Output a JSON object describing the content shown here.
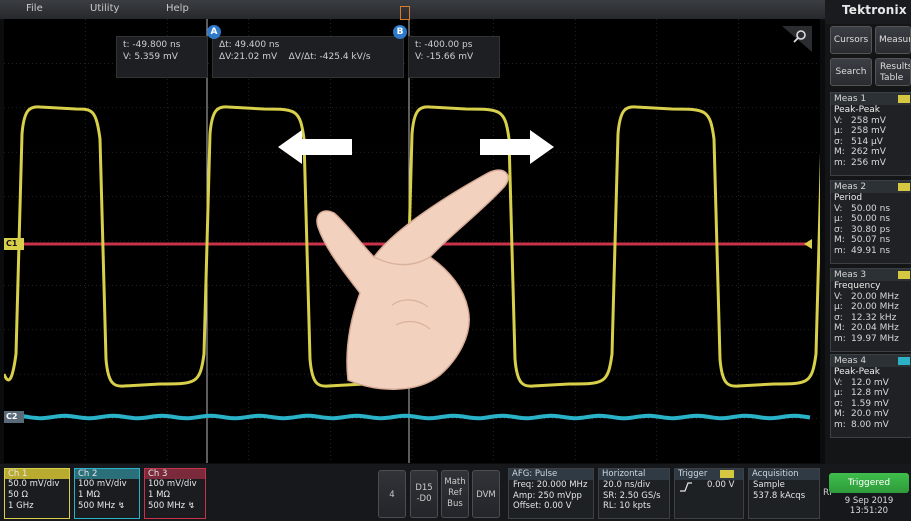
{
  "menu": {
    "file": "File",
    "utility": "Utility",
    "help": "Help"
  },
  "brand": "Tektronix",
  "side_buttons": {
    "cursors": "Cursors",
    "measure": "Measure",
    "search": "Search",
    "results_table": "Results Table"
  },
  "readouts": {
    "a": {
      "t": "t:  -49.800 ns",
      "v": "V:  5.359 mV"
    },
    "delta": {
      "dt": "Δt: 49.400 ns",
      "dv": "ΔV:21.02 mV",
      "dvdt": "ΔV/Δt: -425.4 kV/s"
    },
    "b": {
      "t": "t:    -400.00 ps",
      "v": "V:  -15.66 mV"
    }
  },
  "cursor_labels": {
    "a": "A",
    "b": "B"
  },
  "channel_markers": {
    "c1": "C1",
    "c2": "C2"
  },
  "measurements": [
    {
      "header": "Meas 1",
      "name": "Peak-Peak",
      "rows": [
        [
          "V:",
          "258 mV"
        ],
        [
          "μ:",
          "258 mV"
        ],
        [
          "σ:",
          "514 μV"
        ],
        [
          "M:",
          "262 mV"
        ],
        [
          "m:",
          "256 mV"
        ]
      ]
    },
    {
      "header": "Meas 2",
      "name": "Period",
      "rows": [
        [
          "V:",
          "50.00 ns"
        ],
        [
          "μ:",
          "50.00 ns"
        ],
        [
          "σ:",
          "30.80 ps"
        ],
        [
          "M:",
          "50.07 ns"
        ],
        [
          "m:",
          "49.91 ns"
        ]
      ]
    },
    {
      "header": "Meas 3",
      "name": "Frequency",
      "rows": [
        [
          "V:",
          "20.00 MHz"
        ],
        [
          "μ:",
          "20.00 MHz"
        ],
        [
          "σ:",
          "12.32 kHz"
        ],
        [
          "M:",
          "20.04 MHz"
        ],
        [
          "m:",
          "19.97 MHz"
        ]
      ]
    },
    {
      "header": "Meas 4",
      "name": "Peak-Peak",
      "rows": [
        [
          "V:",
          "12.0 mV"
        ],
        [
          "μ:",
          "12.8 mV"
        ],
        [
          "σ:",
          "1.59 mV"
        ],
        [
          "M:",
          "20.0 mV"
        ],
        [
          "m:",
          "8.00 mV"
        ]
      ]
    }
  ],
  "channels": [
    {
      "name": "Ch 1",
      "l1": "50.0 mV/div",
      "l2": "50 Ω",
      "l3": "1 GHz"
    },
    {
      "name": "Ch 2",
      "l1": "100 mV/div",
      "l2": "1 MΩ",
      "l3": "500 MHz ↯"
    },
    {
      "name": "Ch 3",
      "l1": "100 mV/div",
      "l2": "1 MΩ",
      "l3": "500 MHz ↯"
    }
  ],
  "buttons": {
    "four": "4",
    "d15": "D15",
    "d0": "-D0",
    "math": "Math",
    "ref": "Ref",
    "bus": "Bus",
    "dvm": "DVM"
  },
  "afg": {
    "title": "AFG: Pulse",
    "freq": "Freq: 20.000 MHz",
    "amp": "Amp: 250 mVpp",
    "offset": "Offset: 0.00 V"
  },
  "horizontal": {
    "title": "Horizontal",
    "scale": "20.0 ns/div",
    "sr": "SR: 2.50 GS/s",
    "rl": "RL: 10 kpts"
  },
  "trigger": {
    "title": "Trigger",
    "level": "0.00 V"
  },
  "acquisition": {
    "title": "Acquisition",
    "mode": "Sample",
    "count": "537.8 kAcqs"
  },
  "rf": "RF",
  "status": {
    "triggered": "Triggered",
    "date": "9 Sep 2019",
    "time": "13:51:20"
  },
  "colors": {
    "ch1": "#d8d04a",
    "ch2": "#2ab3c8",
    "ch3": "#c8334a",
    "grid": "#3a3a3a",
    "cursor": "#b8b8b8"
  }
}
